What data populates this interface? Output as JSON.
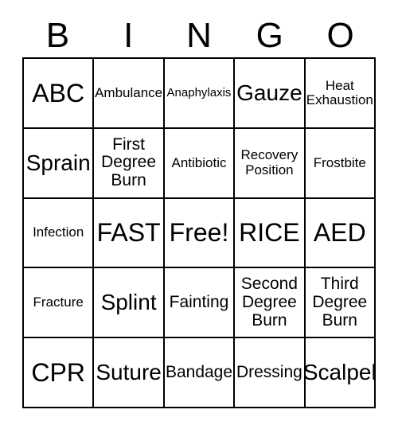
{
  "header": {
    "letters": [
      "B",
      "I",
      "N",
      "G",
      "O"
    ]
  },
  "colors": {
    "border": "#000000",
    "text": "#000000",
    "background": "#ffffff"
  },
  "grid": {
    "rows": 5,
    "columns": 5,
    "cells": [
      [
        {
          "label": "ABC",
          "size": "xl"
        },
        {
          "label": "Ambulance",
          "size": "sm"
        },
        {
          "label": "Anaphylaxis",
          "size": "xs"
        },
        {
          "label": "Gauze",
          "size": "lg"
        },
        {
          "label": "Heat Exhaustion",
          "size": "sm"
        }
      ],
      [
        {
          "label": "Sprain",
          "size": "lg"
        },
        {
          "label": "First Degree Burn",
          "size": "md"
        },
        {
          "label": "Antibiotic",
          "size": "sm"
        },
        {
          "label": "Recovery Position",
          "size": "sm"
        },
        {
          "label": "Frostbite",
          "size": "sm"
        }
      ],
      [
        {
          "label": "Infection",
          "size": "sm"
        },
        {
          "label": "FAST",
          "size": "xl"
        },
        {
          "label": "Free!",
          "size": "xl"
        },
        {
          "label": "RICE",
          "size": "xl"
        },
        {
          "label": "AED",
          "size": "xl"
        }
      ],
      [
        {
          "label": "Fracture",
          "size": "sm"
        },
        {
          "label": "Splint",
          "size": "lg"
        },
        {
          "label": "Fainting",
          "size": "md"
        },
        {
          "label": "Second Degree Burn",
          "size": "md"
        },
        {
          "label": "Third Degree Burn",
          "size": "md"
        }
      ],
      [
        {
          "label": "CPR",
          "size": "xl"
        },
        {
          "label": "Suture",
          "size": "lg"
        },
        {
          "label": "Bandage",
          "size": "md"
        },
        {
          "label": "Dressing",
          "size": "md"
        },
        {
          "label": "Scalpel",
          "size": "lg"
        }
      ]
    ]
  }
}
